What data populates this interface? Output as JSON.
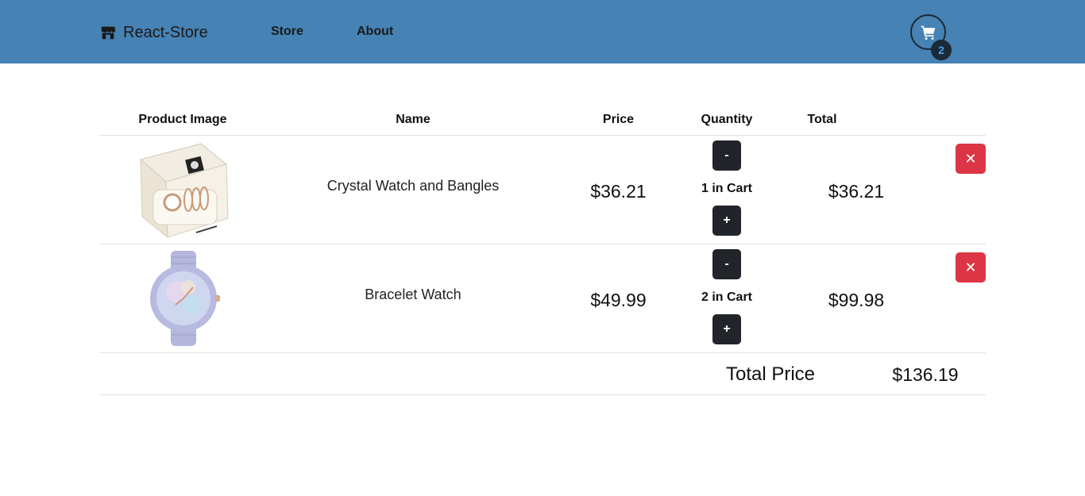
{
  "nav": {
    "brand": "React-Store",
    "brand_icon": "store-icon",
    "links": [
      "Store",
      "About"
    ],
    "cart_icon": "cart-icon",
    "cart_count": "2",
    "bg_color": "#4682b4"
  },
  "table": {
    "headers": [
      "Product Image",
      "Name",
      "Price",
      "Quantity",
      "Total"
    ],
    "rows": [
      {
        "image_icon": "watch-bangle-set-image",
        "name": "Crystal Watch and Bangles",
        "price": "$36.21",
        "decrement": "-",
        "quantity": "1 in Cart",
        "increment": "+",
        "total": "$36.21",
        "remove": "✕"
      },
      {
        "image_icon": "lavender-watch-image",
        "name": "Bracelet Watch",
        "price": "$49.99",
        "decrement": "-",
        "quantity": "2 in Cart",
        "increment": "+",
        "total": "$99.98",
        "remove": "✕"
      }
    ]
  },
  "summary": {
    "label": "Total Price",
    "value": "$136.19"
  },
  "colors": {
    "dark_button": "#212529",
    "remove_button": "#dc3545"
  }
}
